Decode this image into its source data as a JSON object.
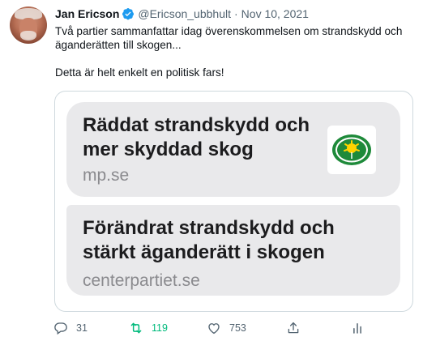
{
  "author": {
    "display_name": "Jan Ericson",
    "handle": "@Ericson_ubbhult",
    "separator": "·",
    "date": "Nov 10, 2021"
  },
  "tweet": {
    "text": "Två partier sammanfattar idag överenskommelsen om strandskydd och äganderätten till skogen...\n\nDetta är helt enkelt en politisk fars!"
  },
  "media": {
    "cards": [
      {
        "title": "Räddat strandskydd och\nmer skyddad skog",
        "domain": "mp.se"
      },
      {
        "title": "Förändrat strandskydd och\nstärkt äganderätt i skogen",
        "domain": "centerpartiet.se"
      }
    ]
  },
  "actions": {
    "reply_count": "31",
    "retweet_count": "119",
    "like_count": "753"
  },
  "colors": {
    "verified": "#1d9bf0",
    "retweet_active": "#00ba7c",
    "secondary_text": "#536471",
    "card_bg": "#e9e9eb"
  },
  "icons": [
    "verified-badge-icon",
    "reply-icon",
    "retweet-icon",
    "like-icon",
    "share-icon",
    "analytics-icon",
    "party-logo-icon"
  ]
}
